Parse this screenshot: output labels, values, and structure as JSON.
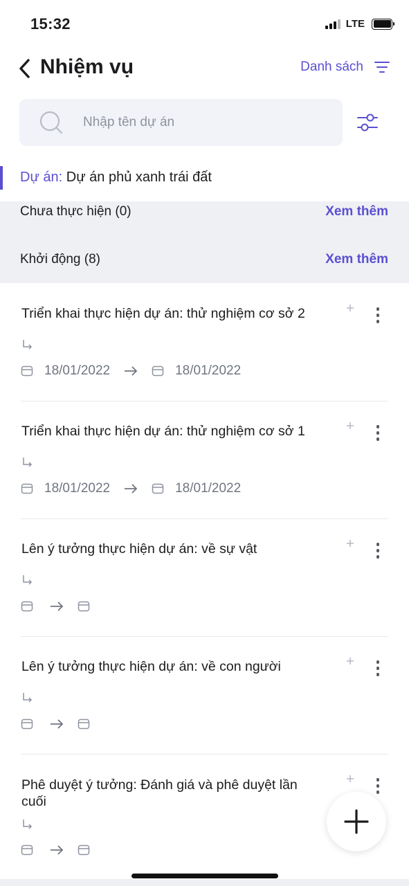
{
  "status_bar": {
    "time": "15:32",
    "network": "LTE",
    "icons": [
      "signal-icon",
      "battery-icon"
    ]
  },
  "header": {
    "back_icon": "chevron-left-icon",
    "title": "Nhiệm vụ",
    "view_label": "Danh sách",
    "view_icon": "list-filter-icon"
  },
  "search": {
    "placeholder": "Nhập tên dự án",
    "value": "",
    "icon": "search-icon",
    "filter_icon": "sliders-icon"
  },
  "project": {
    "key": "Dự án:",
    "value": "Dự án phủ xanh trái đất"
  },
  "groups": [
    {
      "title": "Chưa thực hiện (0)",
      "more_label": "Xem thêm"
    },
    {
      "title": "Khởi động (8)",
      "more_label": "Xem thêm"
    }
  ],
  "tasks": [
    {
      "title": "Triển khai thực hiện dự án: thử nghiệm cơ sở 2",
      "start_date": "18/01/2022",
      "end_date": "18/01/2022"
    },
    {
      "title": "Triển khai thực hiện dự án: thử nghiệm cơ sở 1",
      "start_date": "18/01/2022",
      "end_date": "18/01/2022"
    },
    {
      "title": "Lên ý tưởng thực hiện dự án: về sự vật",
      "start_date": "",
      "end_date": ""
    },
    {
      "title": "Lên ý tưởng thực hiện dự án: về con người",
      "start_date": "",
      "end_date": ""
    },
    {
      "title": "Phê duyệt ý tưởng: Đánh giá và phê duyệt lần cuối",
      "start_date": "",
      "end_date": ""
    }
  ],
  "fab": {
    "icon": "plus-icon"
  },
  "colors": {
    "accent": "#5b4fd1",
    "group_bg": "#eef0f4",
    "search_bg": "#f1f3f8",
    "muted_text": "#707580"
  }
}
